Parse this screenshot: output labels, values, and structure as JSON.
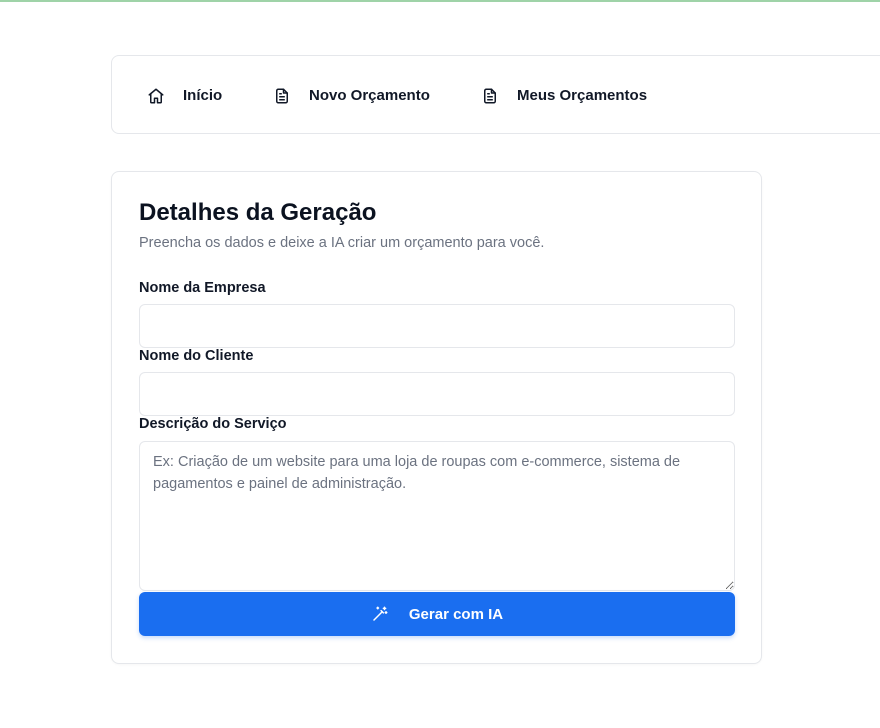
{
  "nav": {
    "items": [
      {
        "label": "Início",
        "icon": "home-icon"
      },
      {
        "label": "Novo Orçamento",
        "icon": "document-icon"
      },
      {
        "label": "Meus Orçamentos",
        "icon": "document-icon"
      }
    ]
  },
  "form": {
    "title": "Detalhes da Geração",
    "subtitle": "Preencha os dados e deixe a IA criar um orçamento para você.",
    "company": {
      "label": "Nome da Empresa",
      "value": "",
      "placeholder": ""
    },
    "client": {
      "label": "Nome do Cliente",
      "value": "",
      "placeholder": ""
    },
    "description": {
      "label": "Descrição do Serviço",
      "value": "",
      "placeholder": "Ex: Criação de um website para uma loja de roupas com e-commerce, sistema de pagamentos e painel de administração."
    },
    "submit": {
      "label": "Gerar com IA",
      "icon": "magic-wand-icon"
    }
  },
  "colors": {
    "primary": "#1a6ef0",
    "border": "#e5e7eb",
    "muted_text": "#6b7280",
    "top_accent": "#9fd3a8"
  }
}
